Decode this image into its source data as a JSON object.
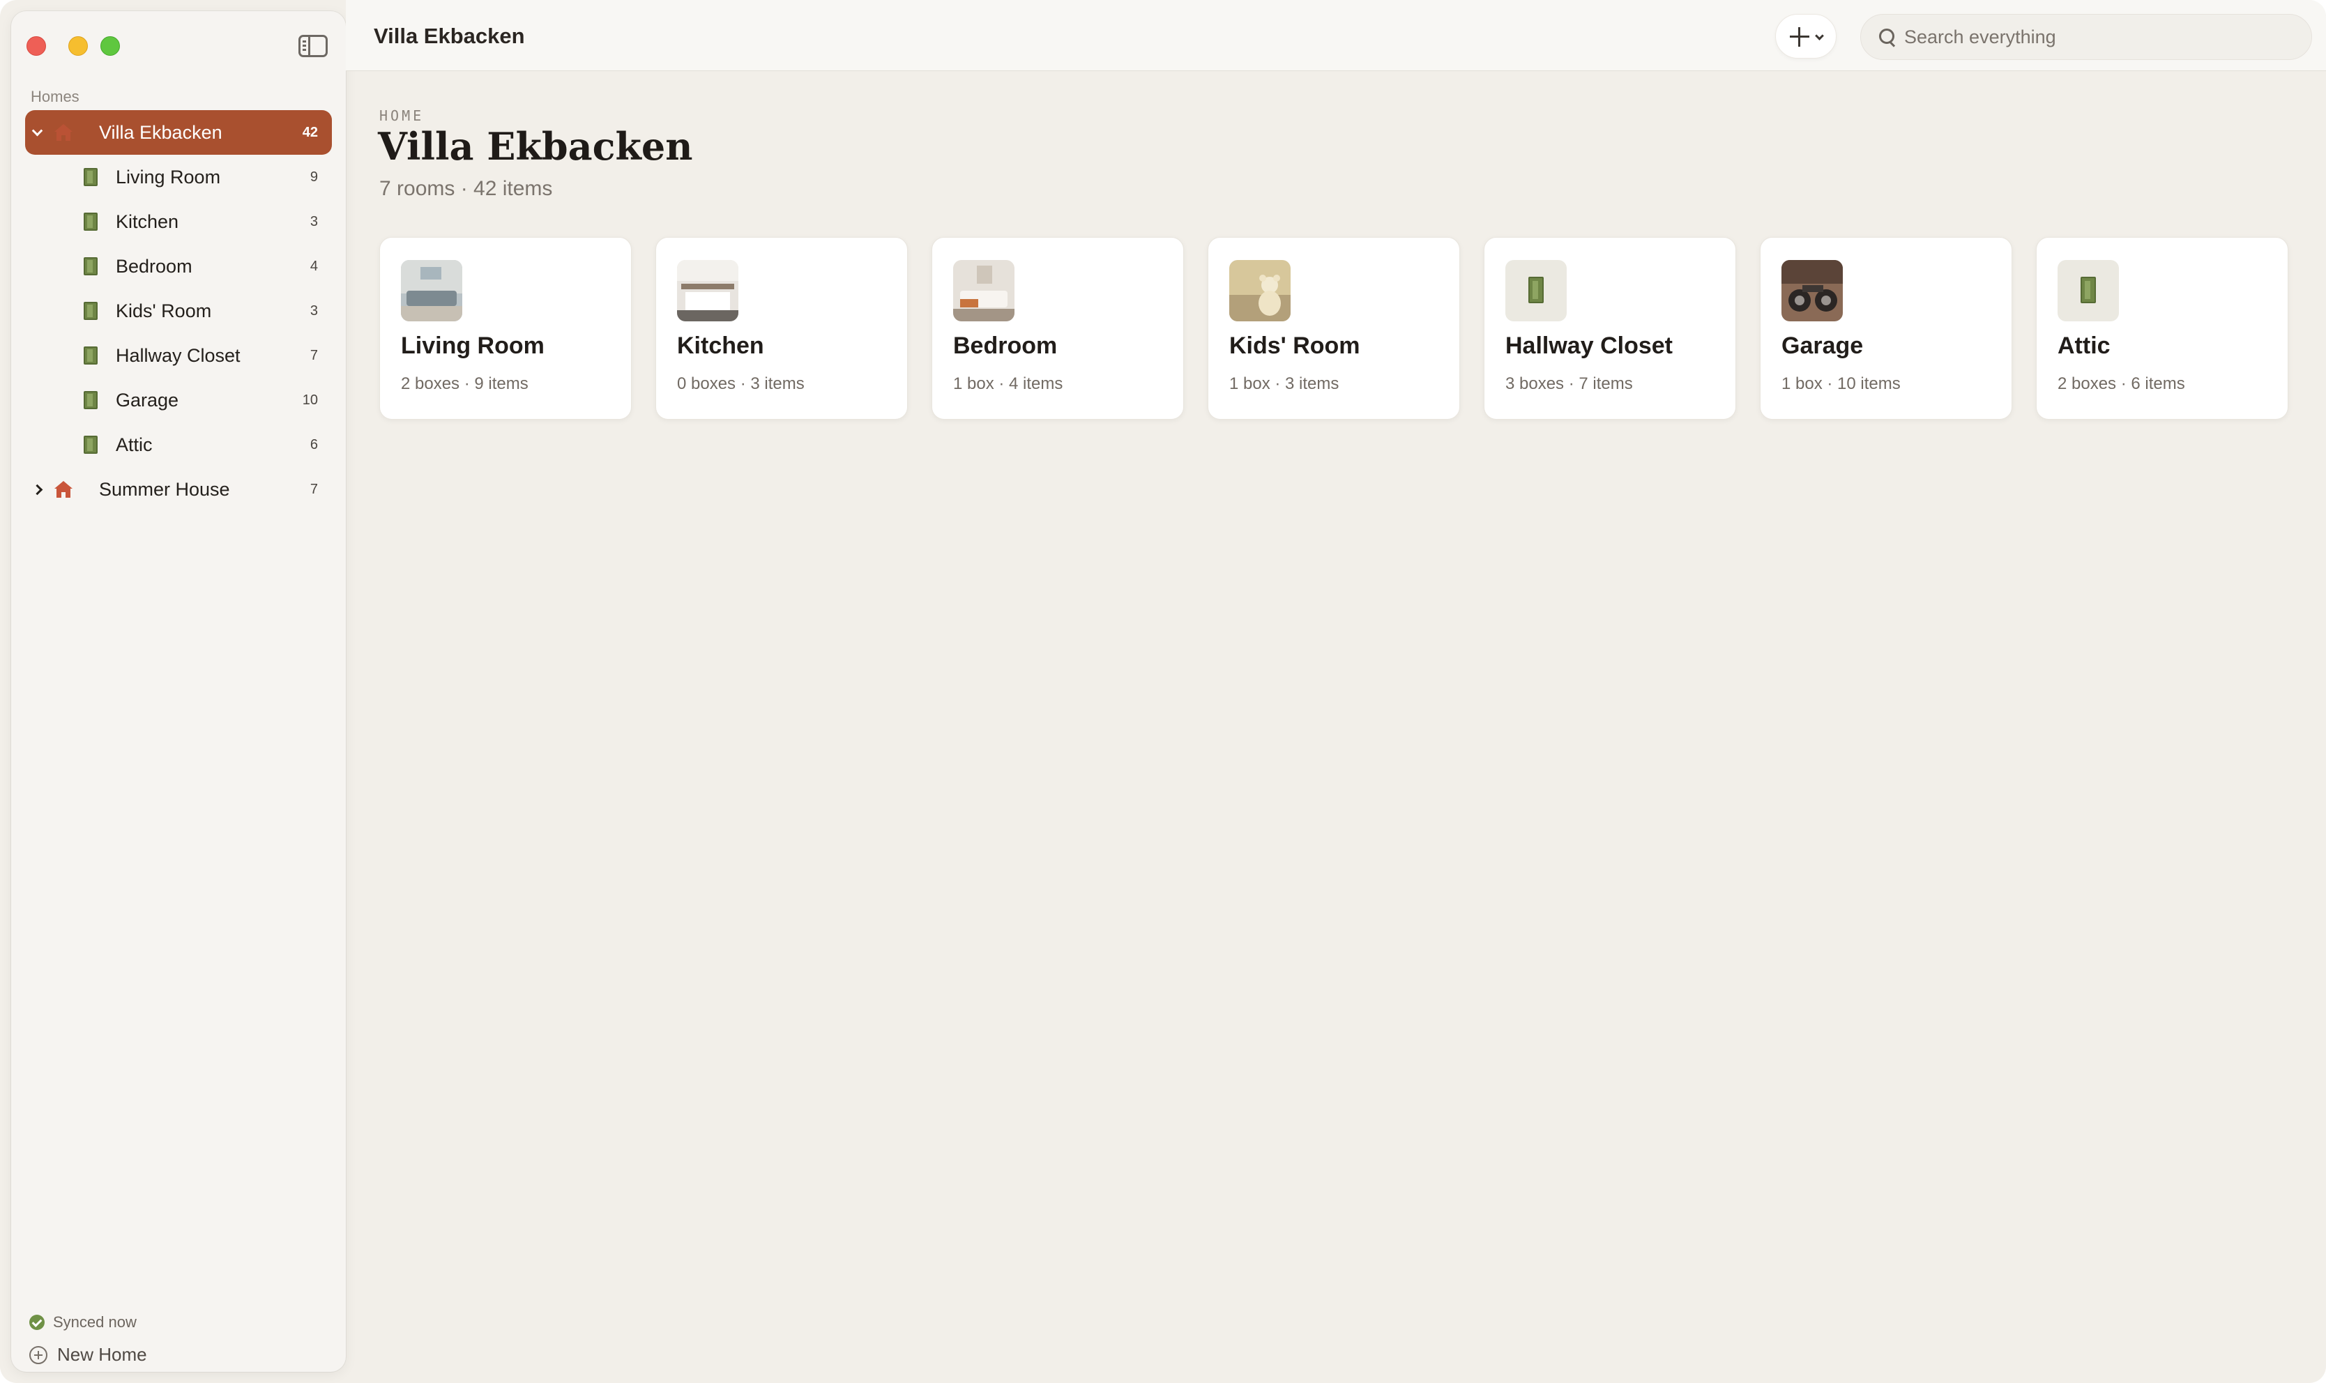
{
  "window": {
    "title": "Villa Ekbacken"
  },
  "sidebar": {
    "section_label": "Homes",
    "homes": [
      {
        "name": "Villa Ekbacken",
        "count": "42",
        "expanded": true,
        "selected": true,
        "rooms": [
          {
            "name": "Living Room",
            "count": "9"
          },
          {
            "name": "Kitchen",
            "count": "3"
          },
          {
            "name": "Bedroom",
            "count": "4"
          },
          {
            "name": "Kids' Room",
            "count": "3"
          },
          {
            "name": "Hallway Closet",
            "count": "7"
          },
          {
            "name": "Garage",
            "count": "10"
          },
          {
            "name": "Attic",
            "count": "6"
          }
        ]
      },
      {
        "name": "Summer House",
        "count": "7",
        "expanded": false,
        "selected": false
      }
    ],
    "sync_status": "Synced now",
    "new_home_label": "New Home"
  },
  "toolbar": {
    "add_icon": "plus-icon",
    "search_placeholder": "Search everything"
  },
  "main": {
    "eyebrow": "HOME",
    "title": "Villa Ekbacken",
    "subtitle": "7 rooms · 42 items",
    "rooms": [
      {
        "name": "Living Room",
        "meta": "2 boxes · 9 items",
        "thumb": "photo"
      },
      {
        "name": "Kitchen",
        "meta": "0 boxes · 3 items",
        "thumb": "photo"
      },
      {
        "name": "Bedroom",
        "meta": "1 box · 4 items",
        "thumb": "photo"
      },
      {
        "name": "Kids' Room",
        "meta": "1 box · 3 items",
        "thumb": "photo"
      },
      {
        "name": "Hallway Closet",
        "meta": "3 boxes · 7 items",
        "thumb": "door-icon"
      },
      {
        "name": "Garage",
        "meta": "1 box · 10 items",
        "thumb": "photo"
      },
      {
        "name": "Attic",
        "meta": "2 boxes · 6 items",
        "thumb": "door-icon"
      }
    ]
  },
  "colors": {
    "accent": "#a9502f",
    "background": "#f2efe9",
    "sidebar": "#f6f4f1",
    "door_green": "#6f8646",
    "sync_green": "#6f9146",
    "home_icon": "#c9553a"
  }
}
